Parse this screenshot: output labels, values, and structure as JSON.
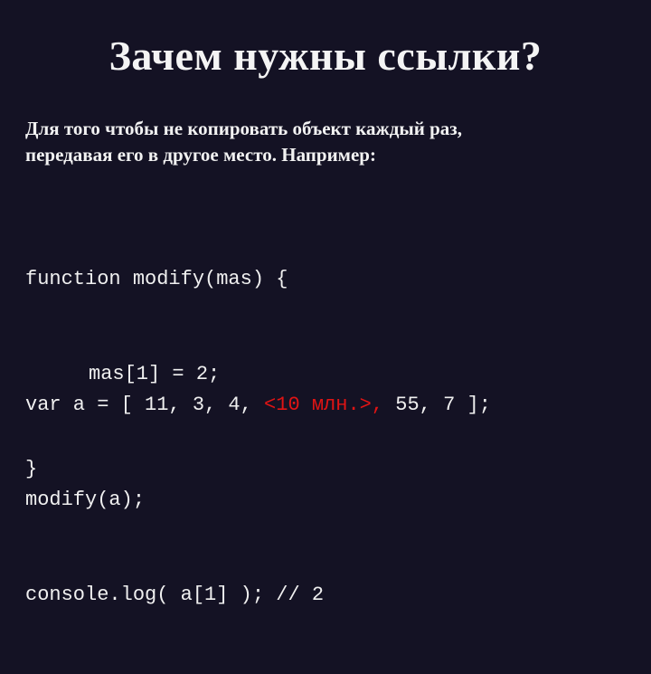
{
  "slide": {
    "title": "Зачем нужны ссылки?",
    "intro_lines": [
      "Для того чтобы не копировать объект каждый раз,",
      "передавая его в другое место. Например:"
    ],
    "code_block_1": [
      "function modify(mas) {",
      "mas[1] = 2;",
      "}"
    ],
    "code_block_2": {
      "line1_before": "var a = [ 11, 3, 4, ",
      "line1_highlight": "<10 млн.>,",
      "line1_after": " 55, 7 ];",
      "line2": "modify(a);",
      "line3": "console.log( a[1] ); // 2"
    },
    "colors": {
      "background": "#141224",
      "text": "#f2f2f2",
      "highlight": "#e01414"
    }
  }
}
